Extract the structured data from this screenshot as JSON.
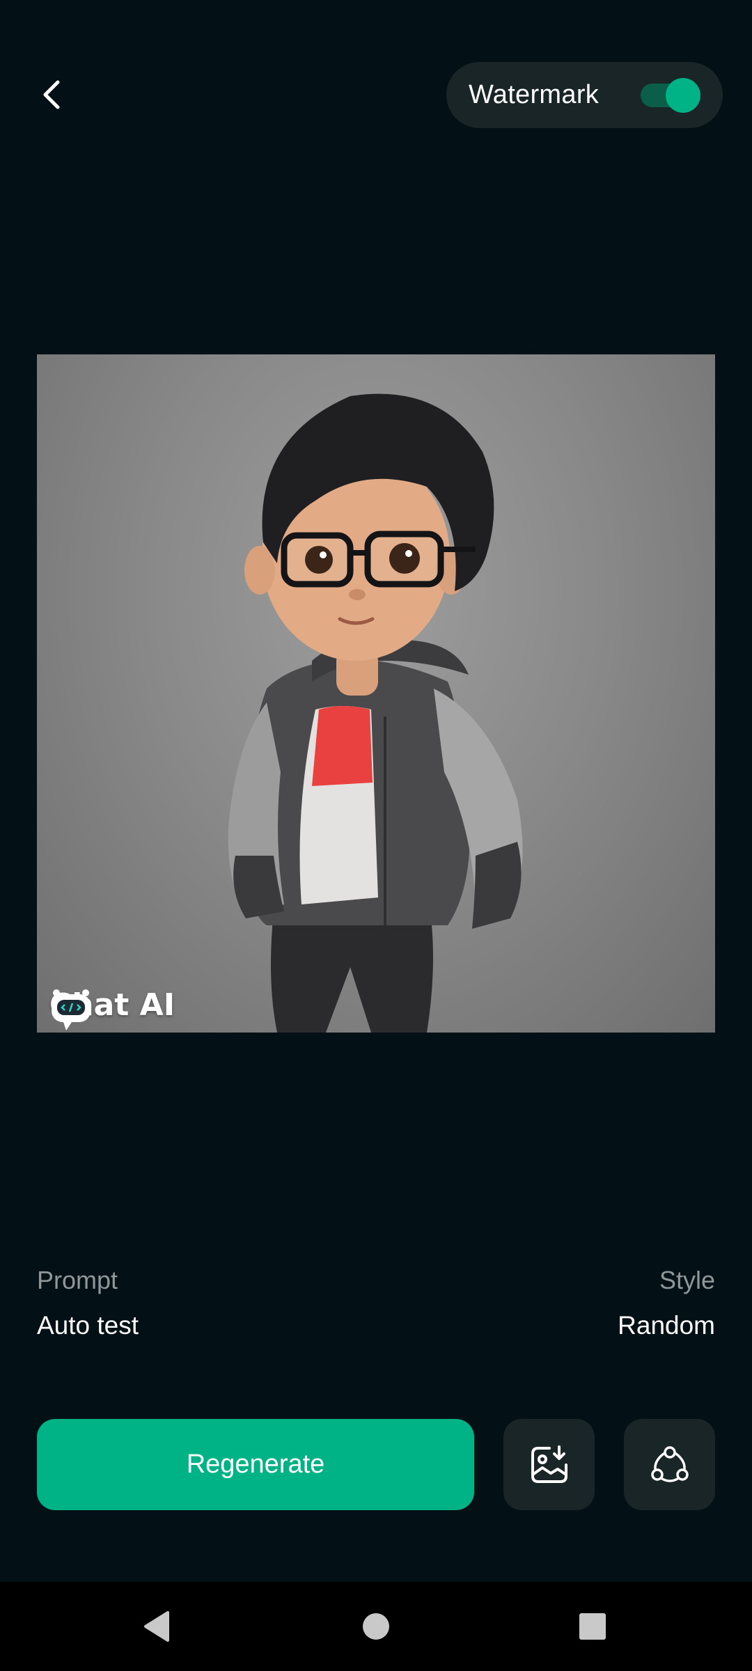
{
  "header": {
    "back_icon": "chevron-left-icon",
    "watermark_label": "Watermark",
    "watermark_enabled": true
  },
  "image": {
    "watermark_text": "Chat AI",
    "watermark_logo_icon": "robot-chat-icon"
  },
  "details": {
    "prompt_label": "Prompt",
    "prompt_value": "Auto test",
    "style_label": "Style",
    "style_value": "Random"
  },
  "actions": {
    "regenerate_label": "Regenerate",
    "save_icon": "image-download-icon",
    "share_icon": "share-icon"
  },
  "navbar": {
    "back_icon": "nav-back-triangle-icon",
    "home_icon": "nav-home-circle-icon",
    "recents_icon": "nav-recents-square-icon"
  },
  "colors": {
    "background": "#031015",
    "accent": "#00b386",
    "surface": "#1a2528",
    "muted_text": "#8f9799"
  }
}
